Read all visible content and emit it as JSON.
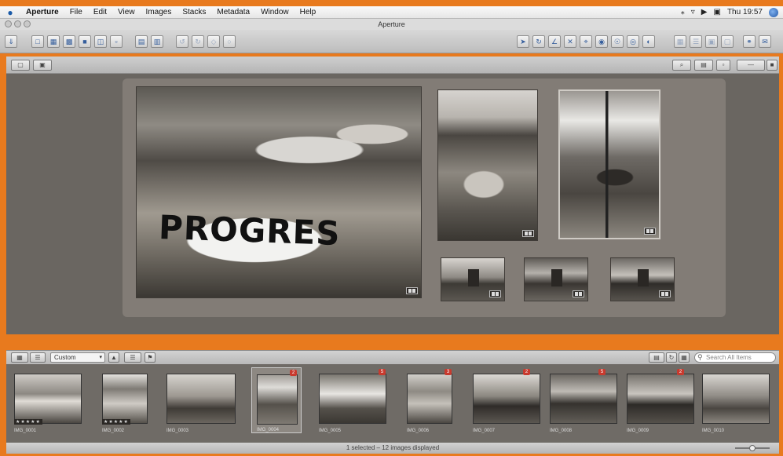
{
  "menubar": {
    "app_name": "Aperture",
    "items": [
      "File",
      "Edit",
      "View",
      "Images",
      "Stacks",
      "Metadata",
      "Window",
      "Help"
    ],
    "clock": "Thu 19:57"
  },
  "window": {
    "title": "Aperture"
  },
  "toolbar": {
    "left_buttons": [
      "import-icon",
      "new-project-icon",
      "new-album-icon",
      "new-smart-album-icon",
      "new-light-table-icon",
      "new-book-icon",
      "new-web-gallery-icon",
      "stack-icon",
      "unstack-icon",
      "rotate-left-icon",
      "rotate-right-icon",
      "compare-icon"
    ],
    "tool_buttons": [
      "select-icon",
      "rotate-tool-icon",
      "straighten-icon",
      "crop-icon",
      "loupe-icon",
      "lift-stamp-icon",
      "red-eye-icon",
      "spot-patch-icon",
      "adjust-icon"
    ],
    "right_buttons": [
      "grid-view-icon",
      "list-view-icon",
      "viewer-mode-icon",
      "full-screen-icon",
      "loupe-tool-icon",
      "email-icon"
    ]
  },
  "lightbox": {
    "photos": [
      {
        "name": "photo-progres-boat",
        "text": "PROGRES"
      },
      {
        "name": "photo-boat-beach"
      },
      {
        "name": "photo-cross-silhouette"
      },
      {
        "name": "photo-church-1"
      },
      {
        "name": "photo-church-2"
      },
      {
        "name": "photo-church-3"
      }
    ]
  },
  "browser": {
    "sort_label": "Custom",
    "search_placeholder": "Search All Items"
  },
  "filmstrip": {
    "thumbnails": [
      {
        "caption": "IMG_0001",
        "stars": "★★★★★"
      },
      {
        "caption": "IMG_0002",
        "stars": "★★★★★"
      },
      {
        "caption": "IMG_0003"
      },
      {
        "caption": "IMG_0004",
        "badge": "2"
      },
      {
        "caption": "IMG_0005",
        "badge": "5"
      },
      {
        "caption": "IMG_0006",
        "badge": "3"
      },
      {
        "caption": "IMG_0007",
        "badge": "2"
      },
      {
        "caption": "IMG_0008",
        "badge": "5"
      },
      {
        "caption": "IMG_0009",
        "badge": "2"
      },
      {
        "caption": "IMG_0010"
      }
    ]
  },
  "statusbar": {
    "text": "1 selected – 12 images displayed"
  }
}
